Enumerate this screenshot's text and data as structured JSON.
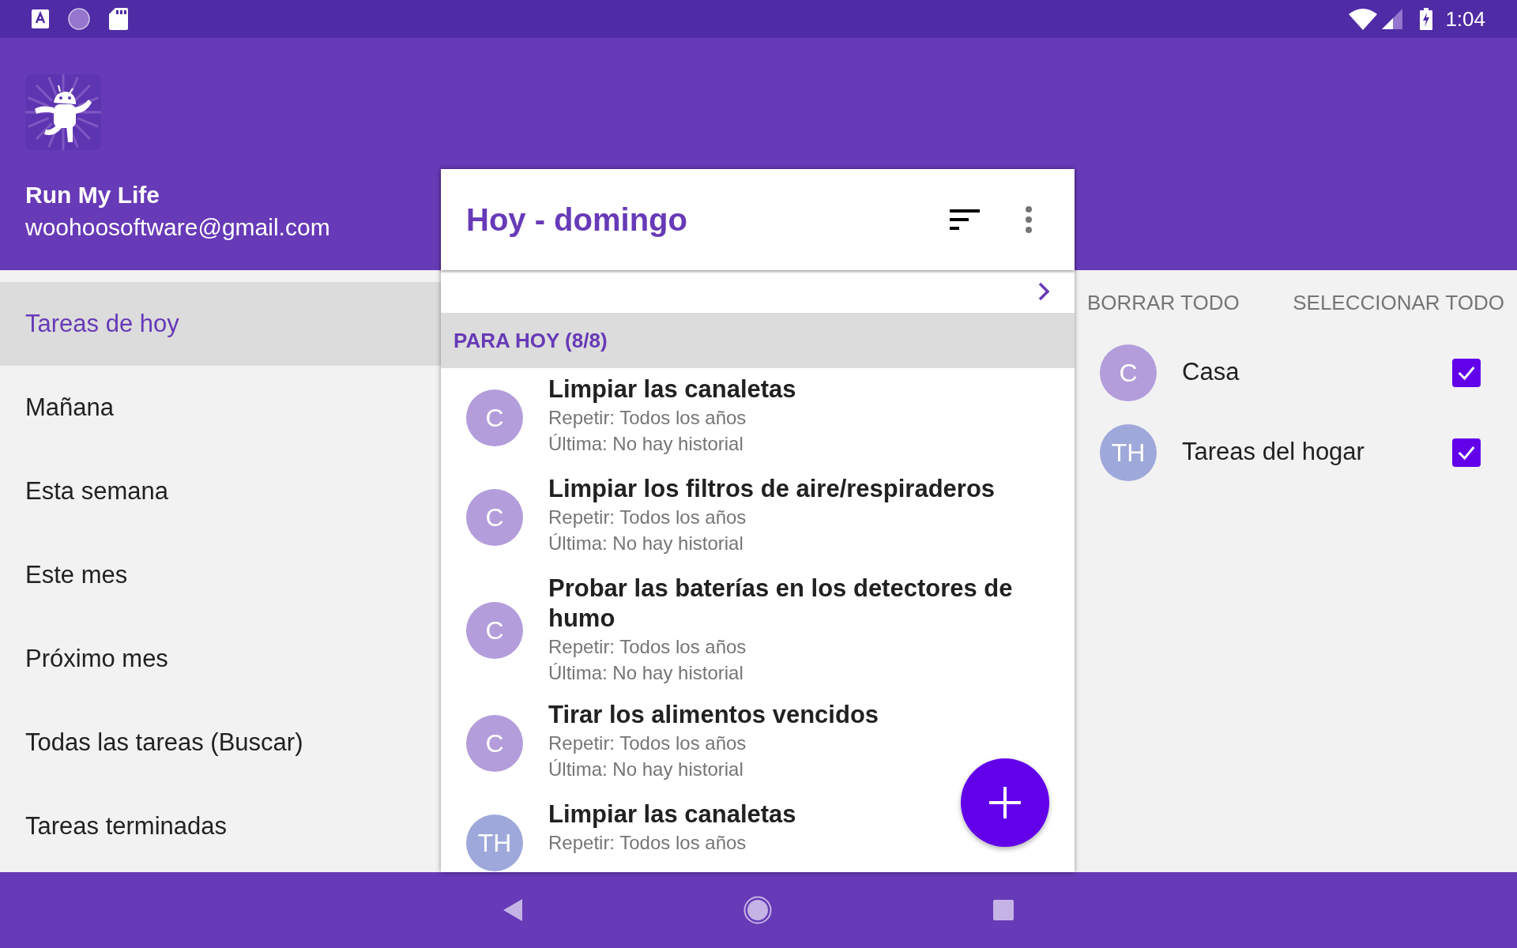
{
  "status_bar": {
    "time": "1:04"
  },
  "drawer": {
    "app_name": "Run My Life",
    "account": "woohoosoftware@gmail.com",
    "items": [
      {
        "label": "Tareas de hoy",
        "selected": true
      },
      {
        "label": "Mañana",
        "selected": false
      },
      {
        "label": "Esta semana",
        "selected": false
      },
      {
        "label": "Este mes",
        "selected": false
      },
      {
        "label": "Próximo mes",
        "selected": false
      },
      {
        "label": "Todas las tareas (Buscar)",
        "selected": false
      },
      {
        "label": "Tareas terminadas",
        "selected": false
      }
    ]
  },
  "main": {
    "title": "Hoy - domingo",
    "section": "PARA HOY (8/8)",
    "tasks": [
      {
        "initials": "C",
        "color": "#b39ddb",
        "title": "Limpiar las canaletas",
        "repeat": "Repetir: Todos los años",
        "last": "Última: No hay historial"
      },
      {
        "initials": "C",
        "color": "#b39ddb",
        "title": "Limpiar los filtros de aire/respiraderos",
        "repeat": "Repetir: Todos los años",
        "last": "Última: No hay historial"
      },
      {
        "initials": "C",
        "color": "#b39ddb",
        "title": "Probar las baterías en los detectores de humo",
        "repeat": "Repetir: Todos los años",
        "last": "Última: No hay historial"
      },
      {
        "initials": "C",
        "color": "#b39ddb",
        "title": "Tirar los alimentos vencidos",
        "repeat": "Repetir: Todos los años",
        "last": "Última: No hay historial"
      },
      {
        "initials": "TH",
        "color": "#9fa8da",
        "title": "Limpiar las canaletas",
        "repeat": "Repetir: Todos los años"
      }
    ]
  },
  "filter": {
    "actions": [
      "BORRAR TODO",
      "SELECCIONAR TODO"
    ],
    "categories": [
      {
        "initials": "C",
        "color": "#b39ddb",
        "name": "Casa",
        "checked": true
      },
      {
        "initials": "TH",
        "color": "#9fa8da",
        "name": "Tareas del hogar",
        "checked": true
      }
    ]
  }
}
